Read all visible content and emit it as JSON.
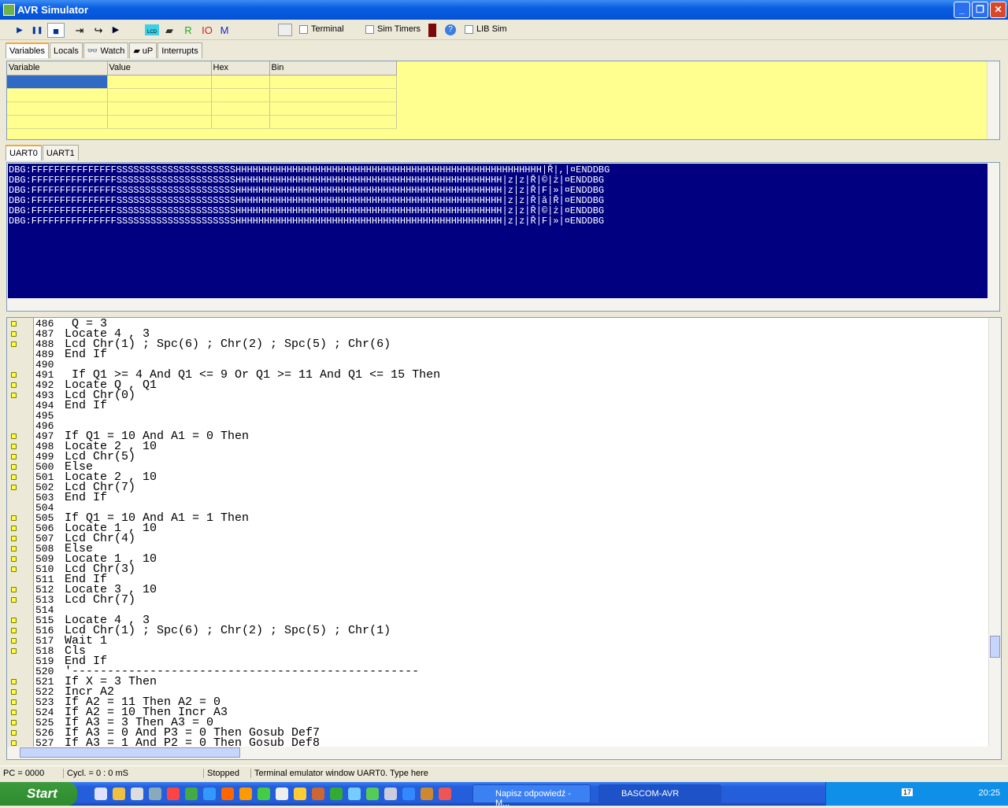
{
  "window": {
    "title": "AVR Simulator",
    "minimize": "_",
    "maximize": "❐",
    "close": "✕"
  },
  "toolbar": {
    "run": "▶",
    "pause": "❚❚",
    "stop": "■",
    "step_into": "⇥",
    "step_over": "↪",
    "run_to": "▶",
    "lcd": "LCD",
    "chip": "▰",
    "r": "R",
    "io": "IO",
    "m": "M",
    "terminal": "Terminal",
    "sim_timers": "Sim Timers",
    "help": "?",
    "lib_sim": "LIB Sim",
    "colors": {
      "r": "#22aa22",
      "io": "#cc2222",
      "m": "#2222cc"
    }
  },
  "var_tabs": [
    {
      "label": "Variables",
      "icon": ""
    },
    {
      "label": "Locals",
      "icon": ""
    },
    {
      "label": "Watch",
      "icon": "glasses-icon"
    },
    {
      "label": "uP",
      "icon": "chip-icon"
    },
    {
      "label": "Interrupts",
      "icon": ""
    }
  ],
  "var_table": {
    "columns": [
      "Variable",
      "Value",
      "Hex",
      "Bin"
    ]
  },
  "uart_tabs": [
    "UART0",
    "UART1"
  ],
  "terminal_lines": [
    "DBG:FFFFFFFFFFFFFFFSSSSSSSSSSSSSSSSSSSSSHHHHHHHHHHHHHHHHHHHHHHHHHHHHHHHHHHHHHHHHHHHHHHHHHHHHHH|Ř|,|¤ENDDBG",
    "DBG:FFFFFFFFFFFFFFFSSSSSSSSSSSSSSSSSSSSSHHHHHHHHHHHHHHHHHHHHHHHHHHHHHHHHHHHHHHHHHHHHHHH|z|z|Ř|©|ż|¤ENDDBG",
    "DBG:FFFFFFFFFFFFFFFSSSSSSSSSSSSSSSSSSSSSHHHHHHHHHHHHHHHHHHHHHHHHHHHHHHHHHHHHHHHHHHHHHHH|z|z|Ř|F|»|¤ENDDBG",
    "DBG:FFFFFFFFFFFFFFFSSSSSSSSSSSSSSSSSSSSSHHHHHHHHHHHHHHHHHHHHHHHHHHHHHHHHHHHHHHHHHHHHHHH|z|z|Ř|ă|Ř|¤ENDDBG",
    "DBG:FFFFFFFFFFFFFFFSSSSSSSSSSSSSSSSSSSSSHHHHHHHHHHHHHHHHHHHHHHHHHHHHHHHHHHHHHHHHHHHHHHH|z|z|Ř|©|ż|¤ENDDBG",
    "DBG:FFFFFFFFFFFFFFFSSSSSSSSSSSSSSSSSSSSSHHHHHHHHHHHHHHHHHHHHHHHHHHHHHHHHHHHHHHHHHHHHHHH|z|z|Ř|F|»|¤ENDDBG"
  ],
  "code_lines": [
    {
      "n": "486",
      "t": " Q = 3",
      "bp": true
    },
    {
      "n": "487",
      "t": "Locate 4 , 3",
      "bp": true
    },
    {
      "n": "488",
      "t": "Lcd Chr(1) ; Spc(6) ; Chr(2) ; Spc(5) ; Chr(6)",
      "bp": true
    },
    {
      "n": "489",
      "t": "End If",
      "bp": false
    },
    {
      "n": "490",
      "t": "",
      "bp": false
    },
    {
      "n": "491",
      "t": " If Q1 >= 4 And Q1 <= 9 Or Q1 >= 11 And Q1 <= 15 Then",
      "bp": true
    },
    {
      "n": "492",
      "t": "Locate Q , Q1",
      "bp": true
    },
    {
      "n": "493",
      "t": "Lcd Chr(0)",
      "bp": true
    },
    {
      "n": "494",
      "t": "End If",
      "bp": false
    },
    {
      "n": "495",
      "t": "",
      "bp": false
    },
    {
      "n": "496",
      "t": "",
      "bp": false
    },
    {
      "n": "497",
      "t": "If Q1 = 10 And A1 = 0 Then",
      "bp": true
    },
    {
      "n": "498",
      "t": "Locate 2 , 10",
      "bp": true
    },
    {
      "n": "499",
      "t": "Lcd Chr(5)",
      "bp": true
    },
    {
      "n": "500",
      "t": "Else",
      "bp": true
    },
    {
      "n": "501",
      "t": "Locate 2 , 10",
      "bp": true
    },
    {
      "n": "502",
      "t": "Lcd Chr(7)",
      "bp": true
    },
    {
      "n": "503",
      "t": "End If",
      "bp": false
    },
    {
      "n": "504",
      "t": "",
      "bp": false
    },
    {
      "n": "505",
      "t": "If Q1 = 10 And A1 = 1 Then",
      "bp": true
    },
    {
      "n": "506",
      "t": "Locate 1 , 10",
      "bp": true
    },
    {
      "n": "507",
      "t": "Lcd Chr(4)",
      "bp": true
    },
    {
      "n": "508",
      "t": "Else",
      "bp": true
    },
    {
      "n": "509",
      "t": "Locate 1 , 10",
      "bp": true
    },
    {
      "n": "510",
      "t": "Lcd Chr(3)",
      "bp": true
    },
    {
      "n": "511",
      "t": "End If",
      "bp": false
    },
    {
      "n": "512",
      "t": "Locate 3 , 10",
      "bp": true
    },
    {
      "n": "513",
      "t": "Lcd Chr(7)",
      "bp": true
    },
    {
      "n": "514",
      "t": "",
      "bp": false
    },
    {
      "n": "515",
      "t": "Locate 4 , 3",
      "bp": true
    },
    {
      "n": "516",
      "t": "Lcd Chr(1) ; Spc(6) ; Chr(2) ; Spc(5) ; Chr(1)",
      "bp": true
    },
    {
      "n": "517",
      "t": "Wait 1",
      "bp": true
    },
    {
      "n": "518",
      "t": "Cls",
      "bp": true
    },
    {
      "n": "519",
      "t": "End If",
      "bp": false
    },
    {
      "n": "520",
      "t": "'-------------------------------------------------",
      "bp": false
    },
    {
      "n": "521",
      "t": "If X = 3 Then",
      "bp": true
    },
    {
      "n": "522",
      "t": "Incr A2",
      "bp": true
    },
    {
      "n": "523",
      "t": "If A2 = 11 Then A2 = 0",
      "bp": true
    },
    {
      "n": "524",
      "t": "If A2 = 10 Then Incr A3",
      "bp": true
    },
    {
      "n": "525",
      "t": "If A3 = 3 Then A3 = 0",
      "bp": true
    },
    {
      "n": "526",
      "t": "If A3 = 0 And P3 = 0 Then Gosub Def7",
      "bp": true
    },
    {
      "n": "527",
      "t": "If A3 = 1 And P2 = 0 Then Gosub Def8",
      "bp": true
    }
  ],
  "status": {
    "pc": "PC = 0000",
    "cycles": "Cycl. = 0 : 0 mS",
    "state": "Stopped",
    "hint": "Terminal emulator window UART0. Type here"
  },
  "taskbar": {
    "start": "Start",
    "tasks": [
      "Napisz odpowiedź - M...",
      "BASCOM-AVR"
    ],
    "clock": "20:25",
    "tray_badge": "17"
  }
}
